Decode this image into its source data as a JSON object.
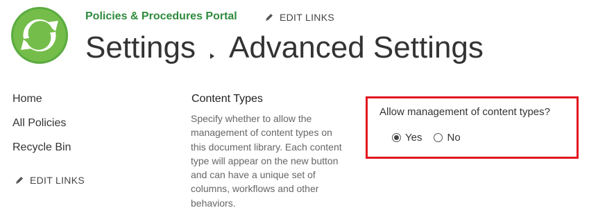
{
  "header": {
    "site_title": "Policies & Procedures Portal",
    "edit_links": "EDIT LINKS",
    "breadcrumb_root": "Settings",
    "breadcrumb_current": "Advanced Settings"
  },
  "leftnav": {
    "items": [
      {
        "label": "Home"
      },
      {
        "label": "All Policies"
      },
      {
        "label": "Recycle Bin"
      }
    ],
    "edit_links": "EDIT LINKS"
  },
  "section": {
    "heading": "Content Types",
    "description": "Specify whether to allow the management of content types on this document library. Each content type will appear on the new button and can have a unique set of columns, workflows and other behaviors.",
    "question": "Allow management of content types?",
    "options": [
      {
        "label": "Yes",
        "selected": true
      },
      {
        "label": "No",
        "selected": false
      }
    ]
  },
  "colors": {
    "brand_green": "#2e8b3d",
    "highlight_red": "#e3161f"
  },
  "icons": {
    "logo": "site-logo-icon",
    "edit": "pencil-icon",
    "breadcrumb": "triangle-right-icon"
  }
}
